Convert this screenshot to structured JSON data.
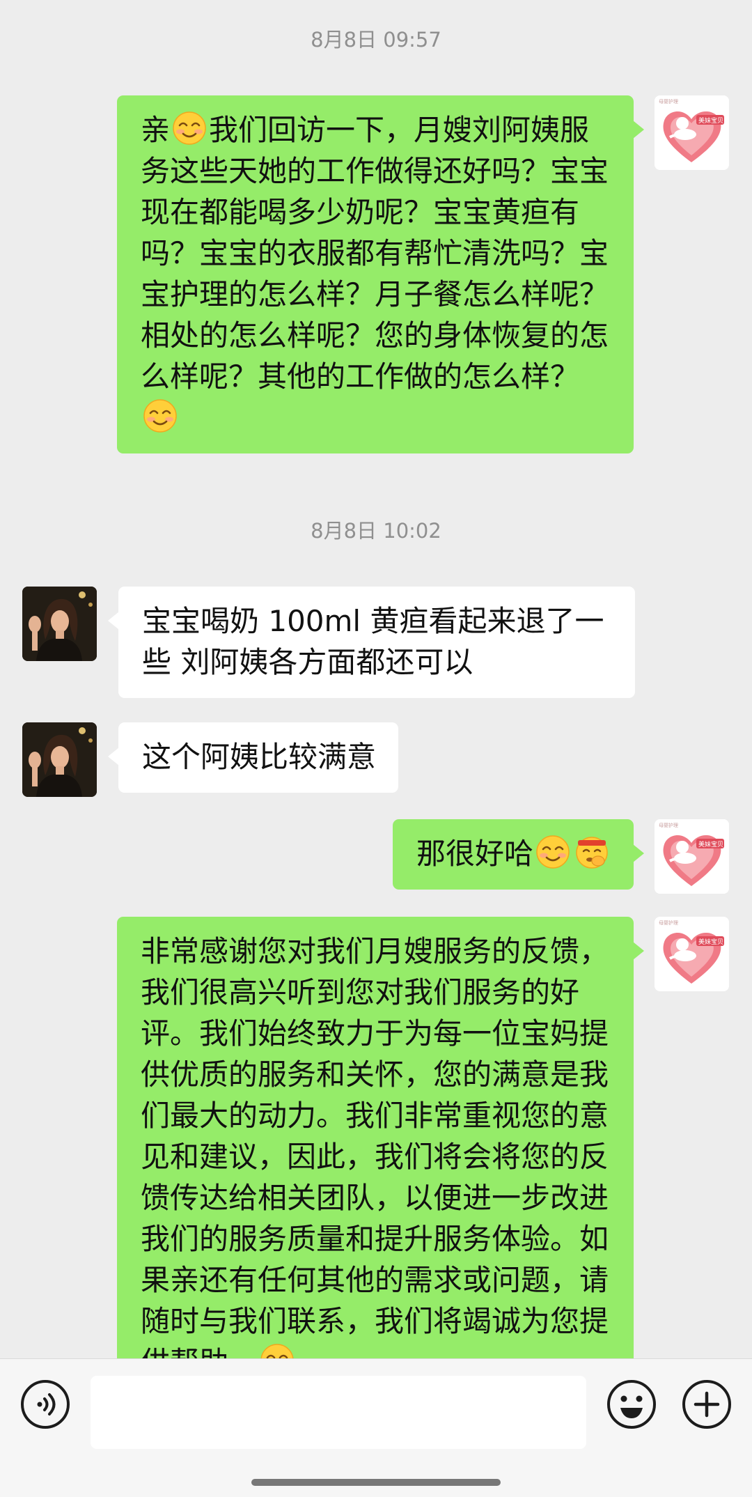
{
  "colors": {
    "background": "#ededed",
    "my_bubble": "#95ec69",
    "their_bubble": "#ffffff"
  },
  "timestamps": [
    "8月8日 09:57",
    "8月8日 10:02"
  ],
  "messages": [
    {
      "sender": "me",
      "segments": [
        "亲",
        "我们回访一下，月嫂刘阿姨服务这些天她的工作做得还好吗？宝宝现在都能喝多少奶呢？宝宝黄疸有吗？宝宝的衣服都有帮忙清洗吗？宝宝护理的怎么样？月子餐怎么样呢？相处的怎么样呢？您的身体恢复的怎么样呢？其他的工作做的怎么样？"
      ],
      "emoji": [
        "smiling-face",
        "smiling-face"
      ]
    },
    {
      "sender": "customer",
      "text": "宝宝喝奶 100ml 黄疸看起来退了一些 刘阿姨各方面都还可以"
    },
    {
      "sender": "customer",
      "text": "这个阿姨比较满意"
    },
    {
      "sender": "me",
      "text": "那很好哈",
      "emoji": [
        "smiling-face",
        "saluting-face"
      ]
    },
    {
      "sender": "me",
      "text": "非常感谢您对我们月嫂服务的反馈，我们很高兴听到您对我们服务的好评。我们始终致力于为每一位宝妈提供优质的服务和关怀，您的满意是我们最大的动力。我们非常重视您的意见和建议，因此，我们将会将您的反馈传达给相关团队，以便进一步改进我们的服务质量和提升服务体验。如果亲还有任何其他的需求或问题，请随时与我们联系，我们将竭诚为您提供帮助。",
      "emoji": [
        "smiling-face"
      ]
    }
  ],
  "avatars": {
    "me": "heart-logo-avatar",
    "customer": "woman-photo-avatar"
  },
  "input_bar": {
    "value": "",
    "icons": [
      "voice-icon",
      "emoji-icon",
      "add-icon"
    ]
  }
}
